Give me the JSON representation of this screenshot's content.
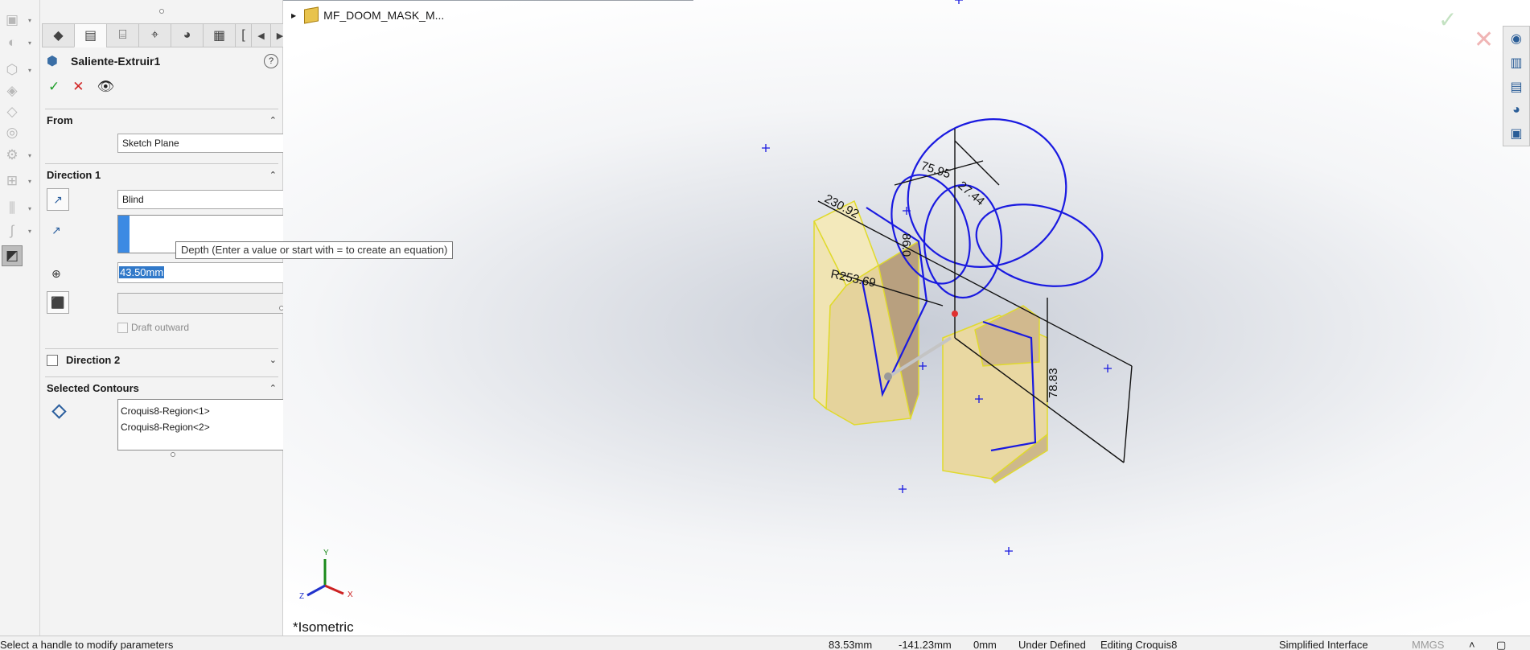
{
  "left_toolbar": {
    "icons": [
      "extrude-boss-icon",
      "revolve-icon",
      "sweep-icon",
      "loft-icon",
      "boundary-icon",
      "fillet-icon",
      "pattern-icon",
      "rib-icon",
      "curves-icon",
      "instant3d-icon"
    ],
    "selected_icon": "instant3d-icon"
  },
  "tabs": [
    "feature-manager-icon",
    "property-manager-icon",
    "configuration-manager-icon",
    "dimxpert-icon",
    "display-manager-icon",
    "cam-icon",
    "more-icon"
  ],
  "feature": {
    "title": "Saliente-Extruir1",
    "help_glyph": "?",
    "ok_glyph": "✓",
    "cancel_glyph": "✕",
    "preview_glyph": "👁"
  },
  "from_section": {
    "title": "From",
    "value": "Sketch Plane"
  },
  "direction1": {
    "title": "Direction 1",
    "end_condition": "Blind",
    "depth": "43.50mm",
    "draft_label": "Draft outward",
    "tooltip": "Depth (Enter a value or start with = to create an equation)"
  },
  "direction2": {
    "title": "Direction 2"
  },
  "contours": {
    "title": "Selected Contours",
    "items": [
      "Croquis8-Region<1>",
      "Croquis8-Region<2>"
    ]
  },
  "viewport": {
    "tree_label": "MF_DOOM_MASK_M...",
    "view_name": "*Isometric",
    "triad_labels": {
      "x": "X",
      "y": "Y",
      "z": "Z"
    },
    "dimensions": [
      "230.92",
      "75.95",
      "27.44",
      "R253.69",
      "78.83",
      "86.0"
    ],
    "right_icons": [
      "view-palette-icon",
      "design-library-icon",
      "file-explorer-icon",
      "appearances-icon",
      "custom-properties-icon"
    ]
  },
  "status": {
    "message": "Select a handle to modify parameters",
    "x": "83.53mm",
    "y": "-141.23mm",
    "z": "0mm",
    "state": "Under Defined",
    "editing": "Editing Croquis8",
    "interface": "Simplified Interface",
    "units": "MMGS"
  },
  "colors": {
    "sketch_blue": "#1a1ae0",
    "body_yellow": "#f1e6b4",
    "accent_blue": "#3c8ae3"
  }
}
